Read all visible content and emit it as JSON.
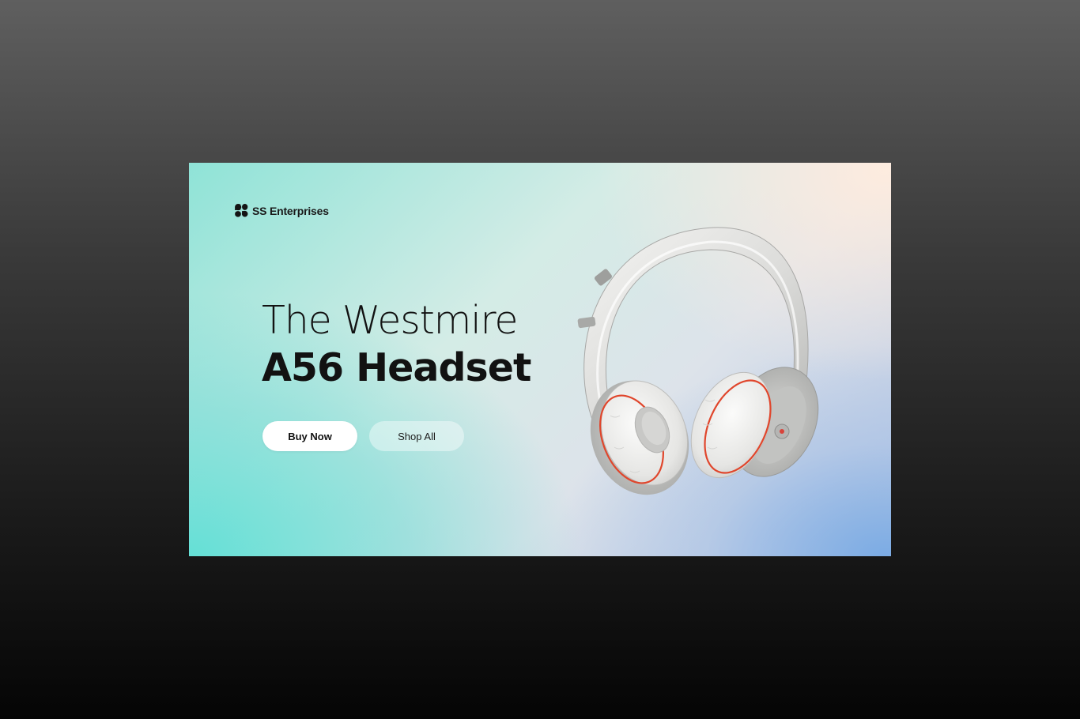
{
  "brand": {
    "name": "SS Enterprises",
    "logo_icon": "clover-logo-icon"
  },
  "hero": {
    "title_line1": "The Westmire",
    "title_line2": "A56 Headset"
  },
  "buttons": {
    "buy_now": "Buy Now",
    "shop_all": "Shop All"
  },
  "product_image": {
    "icon": "headphones-icon"
  },
  "colors": {
    "page_bg_top": "#5f5f5f",
    "page_bg_bottom": "#050505",
    "banner_teal": "#64e0d6",
    "banner_peach": "#ffece0",
    "banner_blue": "#78aae4",
    "text_dark": "#121212",
    "button_primary_bg": "#ffffff",
    "accent_red": "#e0462c"
  }
}
